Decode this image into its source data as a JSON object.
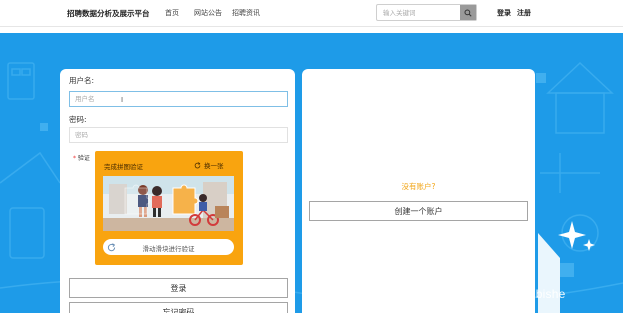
{
  "nav": {
    "brand": "招聘数据分析及展示平台",
    "links": [
      "首页",
      "网站公告",
      "招聘资讯"
    ],
    "search_placeholder": "输入关键词",
    "login": "登录",
    "register": "注册"
  },
  "login_form": {
    "username_label": "用户名:",
    "username_placeholder": "用户名",
    "password_label": "密码:",
    "password_placeholder": "密码",
    "verify_required_mark": "*",
    "verify_label": "验证",
    "captcha": {
      "title": "完成拼图验证",
      "refresh_label": "换一张",
      "slider_text": "滑动滑块进行验证"
    },
    "login_button": "登录",
    "forgot_button": "忘记密码"
  },
  "register_panel": {
    "prompt": "没有账户?",
    "create_button": "创建一个账户"
  },
  "watermark": "CSDN @wxin_VXbishe",
  "colors": {
    "hero_bg": "#1e9be8",
    "captcha_bg": "#f9a40f",
    "prompt": "#f2a516"
  }
}
